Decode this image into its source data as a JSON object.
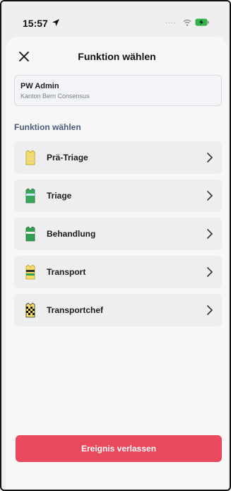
{
  "status_bar": {
    "time": "15:57",
    "signal": "....",
    "accent_battery": "#2fb34a"
  },
  "sheet": {
    "title": "Funktion wählen"
  },
  "account": {
    "name": "PW Admin",
    "organization": "Kanton Bern Consensus"
  },
  "section_title": "Funktion wählen",
  "functions": [
    {
      "label": "Prä-Triage",
      "icon": "vest-yellow-icon"
    },
    {
      "label": "Triage",
      "icon": "vest-green-icon"
    },
    {
      "label": "Behandlung",
      "icon": "vest-green-stripe-icon"
    },
    {
      "label": "Transport",
      "icon": "vest-yellow-stripe-icon"
    },
    {
      "label": "Transportchef",
      "icon": "vest-checker-icon"
    }
  ],
  "footer": {
    "leave_label": "Ereignis verlassen",
    "color": "#e8495d"
  }
}
